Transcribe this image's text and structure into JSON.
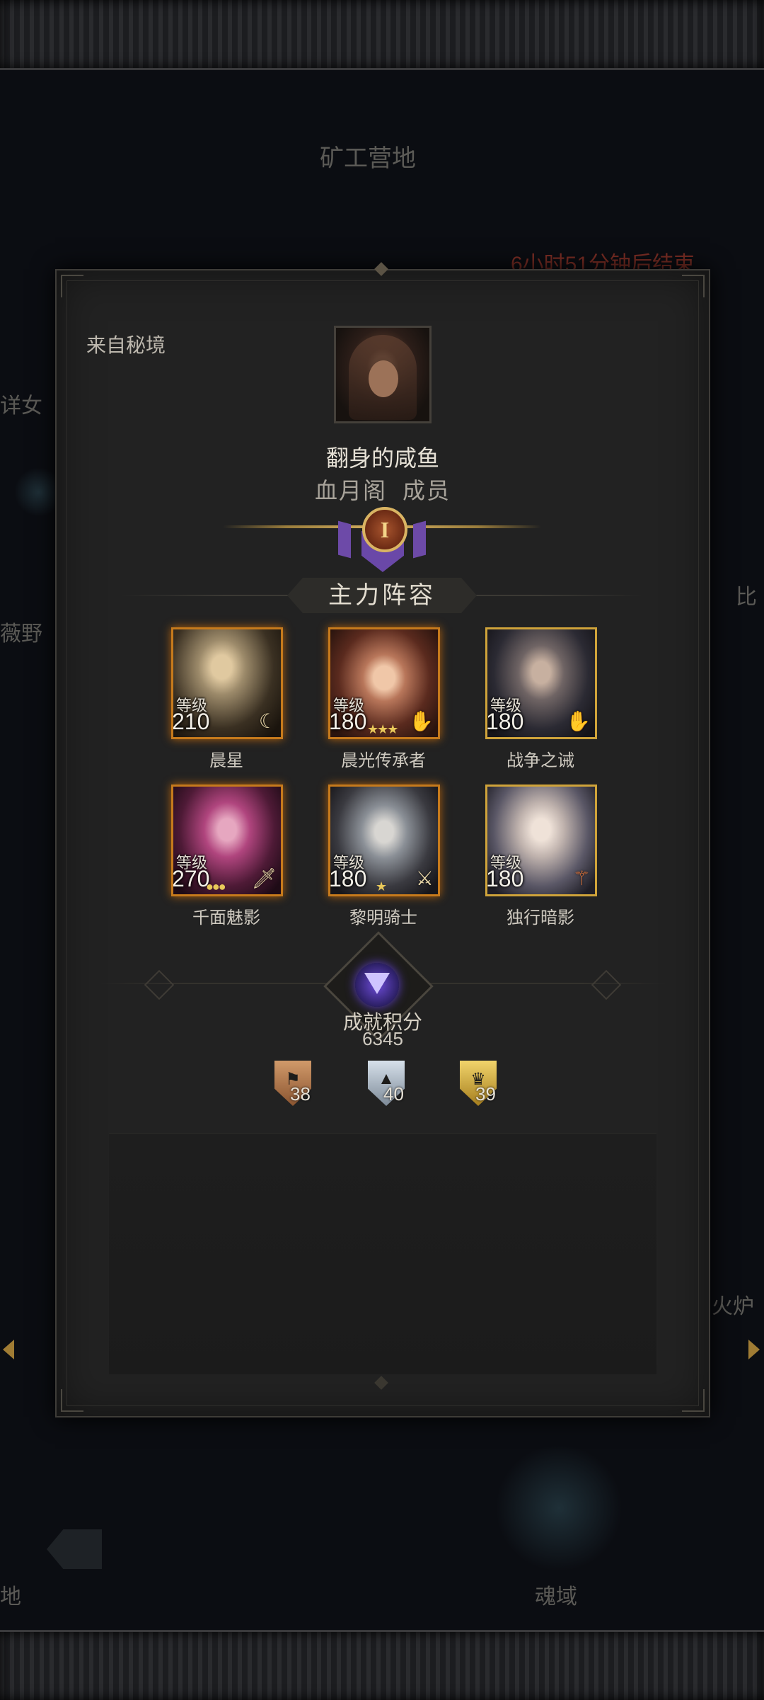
{
  "background": {
    "location_title": "矿工营地",
    "event_timer": "6小时51分钟后结束",
    "left_text_1": "详女",
    "left_text_2": "薇野",
    "right_text_1": "比",
    "right_text_2": "火炉",
    "bottom_left_text": "地",
    "bottom_right_text": "魂域"
  },
  "profile": {
    "source_label": "来自秘境",
    "player_name": "翻身的咸鱼",
    "guild_name": "血月阁",
    "guild_role": "成员",
    "rank_numeral": "I"
  },
  "lineup": {
    "title": "主力阵容",
    "level_label": "等级",
    "heroes": [
      {
        "name": "晨星",
        "level": "210",
        "frame": "orange",
        "emblem": "crescent-icon",
        "stars": ""
      },
      {
        "name": "晨光传承者",
        "level": "180",
        "frame": "orange",
        "emblem": "palm-icon",
        "stars": "★★★"
      },
      {
        "name": "战争之诫",
        "level": "180",
        "frame": "gold",
        "emblem": "palm-icon",
        "stars": ""
      },
      {
        "name": "千面魅影",
        "level": "270",
        "frame": "orange",
        "emblem": "dagger-icon",
        "stars": "●●●"
      },
      {
        "name": "黎明骑士",
        "level": "180",
        "frame": "orange",
        "emblem": "sword-icon",
        "stars": "★"
      },
      {
        "name": "独行暗影",
        "level": "180",
        "frame": "gold",
        "emblem": "scythe-icon",
        "stars": ""
      }
    ]
  },
  "achievement": {
    "title": "成就积分",
    "score": "6345",
    "medals": [
      {
        "name": "bronze-medal-icon",
        "count": "38",
        "color": "#b0764a"
      },
      {
        "name": "silver-medal-icon",
        "count": "40",
        "color": "#a9b6c3"
      },
      {
        "name": "gold-medal-icon",
        "count": "39",
        "color": "#d9b54a"
      }
    ]
  }
}
